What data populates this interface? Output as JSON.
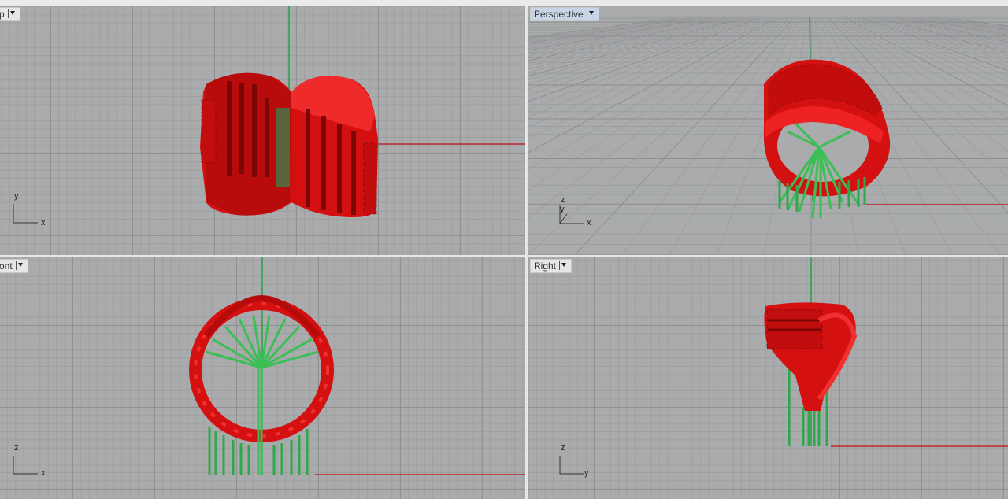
{
  "viewports": {
    "top": {
      "label": "p",
      "axis1": "y",
      "axis2": "x"
    },
    "perspective": {
      "label": "Perspective",
      "axis1": "z",
      "axis2": "x",
      "axis3": "y"
    },
    "front": {
      "label": "ont",
      "axis1": "z",
      "axis2": "x"
    },
    "right": {
      "label": "Right",
      "axis1": "z",
      "axis2": "y"
    }
  },
  "colors": {
    "model": "#e01010",
    "supports": "#3bbf55",
    "x_axis": "#c0262c",
    "y_axis": "#2ba04a",
    "grid": "#a9abad"
  }
}
